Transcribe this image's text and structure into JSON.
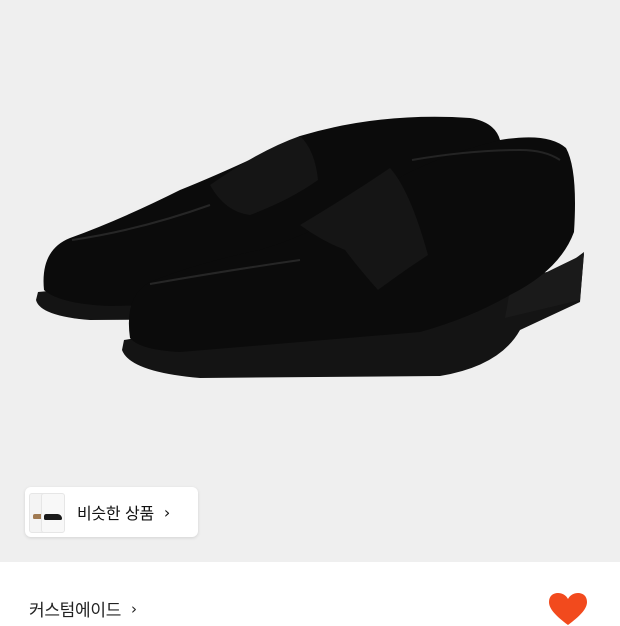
{
  "product": {
    "image_alt_icon": "black-suede-penny-loafers-photo"
  },
  "similar": {
    "label": "비슷한 상품",
    "chevron": "›"
  },
  "brand": {
    "name": "커스텀에이드",
    "chevron": "›"
  },
  "colors": {
    "background": "#efefef",
    "heart": "#f24a1d"
  }
}
